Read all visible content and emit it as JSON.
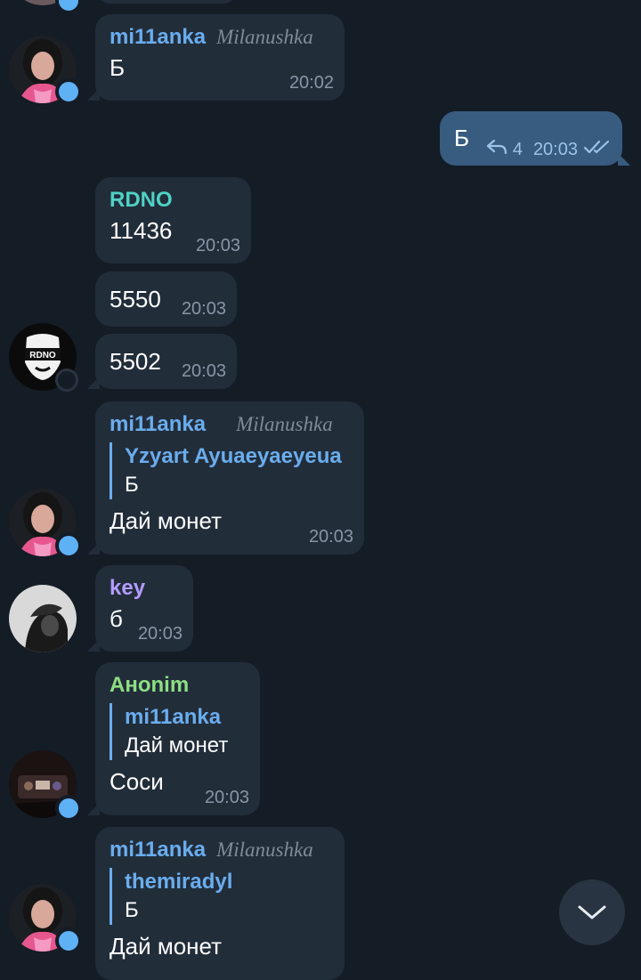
{
  "colors": {
    "background": "#141c26",
    "bubble_in": "#222d3a",
    "bubble_out": "#385b80",
    "name_mi11anka": "#6aadee",
    "name_rdno": "#4fd1c5",
    "name_key": "#b49cff",
    "name_anonim": "#8ddf83",
    "online_dot": "#5fb1f5"
  },
  "messages": [
    {
      "sender": "mi11anka",
      "rank": "Milanushka",
      "text": "Б",
      "time": "20:02"
    },
    {
      "text": "Б",
      "reply_count": "4",
      "time": "20:03",
      "status_icon": "double-check-icon"
    },
    {
      "sender": "RDNO",
      "text": "11436",
      "time": "20:03"
    },
    {
      "text": "5550",
      "time": "20:03"
    },
    {
      "text": "5502",
      "time": "20:03"
    },
    {
      "sender": "mi11anka",
      "rank": "Milanushka",
      "reply_to": {
        "name": "Yzyart Ayuaeyaeyeua",
        "text": "Б"
      },
      "text": "Дай монет",
      "time": "20:03"
    },
    {
      "sender": "key",
      "text": "б",
      "time": "20:03"
    },
    {
      "sender": "Анonim",
      "reply_to": {
        "name": "mi11anka",
        "text": "Дай монет"
      },
      "text": "Соси",
      "time": "20:03"
    },
    {
      "sender": "mi11anka",
      "rank": "Milanushka",
      "reply_to": {
        "name": "themiradyl",
        "text": "Б"
      },
      "text": "Дай монет"
    }
  ],
  "avatar_labels": {
    "rdno": "RDNO"
  },
  "scroll_button_icon": "chevron-down-icon"
}
